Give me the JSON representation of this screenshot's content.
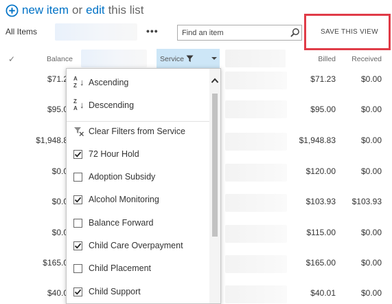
{
  "header": {
    "new_item": "new item",
    "or_text": "or",
    "edit": "edit",
    "list_text": "this list"
  },
  "view": {
    "all_items": "All Items",
    "more_label": "•••",
    "search_placeholder": "Find an item",
    "save_view": "SAVE THIS VIEW"
  },
  "columns": {
    "balance": "Balance",
    "service": "Service",
    "billed": "Billed",
    "received": "Received"
  },
  "rows": [
    {
      "balance": "$71.2",
      "billed": "$71.23",
      "received": "$0.00"
    },
    {
      "balance": "$95.0",
      "billed": "$95.00",
      "received": "$0.00"
    },
    {
      "balance": "$1,948.8",
      "billed": "$1,948.83",
      "received": "$0.00"
    },
    {
      "balance": "$0.0",
      "billed": "$120.00",
      "received": "$0.00"
    },
    {
      "balance": "$0.0",
      "billed": "$103.93",
      "received": "$103.93"
    },
    {
      "balance": "$0.0",
      "billed": "$115.00",
      "received": "$0.00"
    },
    {
      "balance": "$165.0",
      "billed": "$165.00",
      "received": "$0.00"
    },
    {
      "balance": "$40.0",
      "billed": "$40.01",
      "received": "$0.00"
    }
  ],
  "dropdown": {
    "sort": [
      {
        "label": "Ascending",
        "glyph_top": "A",
        "glyph_bottom": "Z",
        "icon": "sort-ascending-icon"
      },
      {
        "label": "Descending",
        "glyph_top": "Z",
        "glyph_bottom": "A",
        "icon": "sort-descending-icon"
      }
    ],
    "clear_filters": "Clear Filters from Service",
    "filters": [
      {
        "label": "72 Hour Hold",
        "checked": true
      },
      {
        "label": "Adoption Subsidy",
        "checked": false
      },
      {
        "label": "Alcohol Monitoring",
        "checked": true
      },
      {
        "label": "Balance Forward",
        "checked": false
      },
      {
        "label": "Child Care Overpayment",
        "checked": true
      },
      {
        "label": "Child Placement",
        "checked": false
      },
      {
        "label": "Child Support",
        "checked": true
      }
    ]
  },
  "colors": {
    "link": "#0072c6",
    "highlight_frame": "#e03b47",
    "service_header_bg": "#cde6f7"
  }
}
